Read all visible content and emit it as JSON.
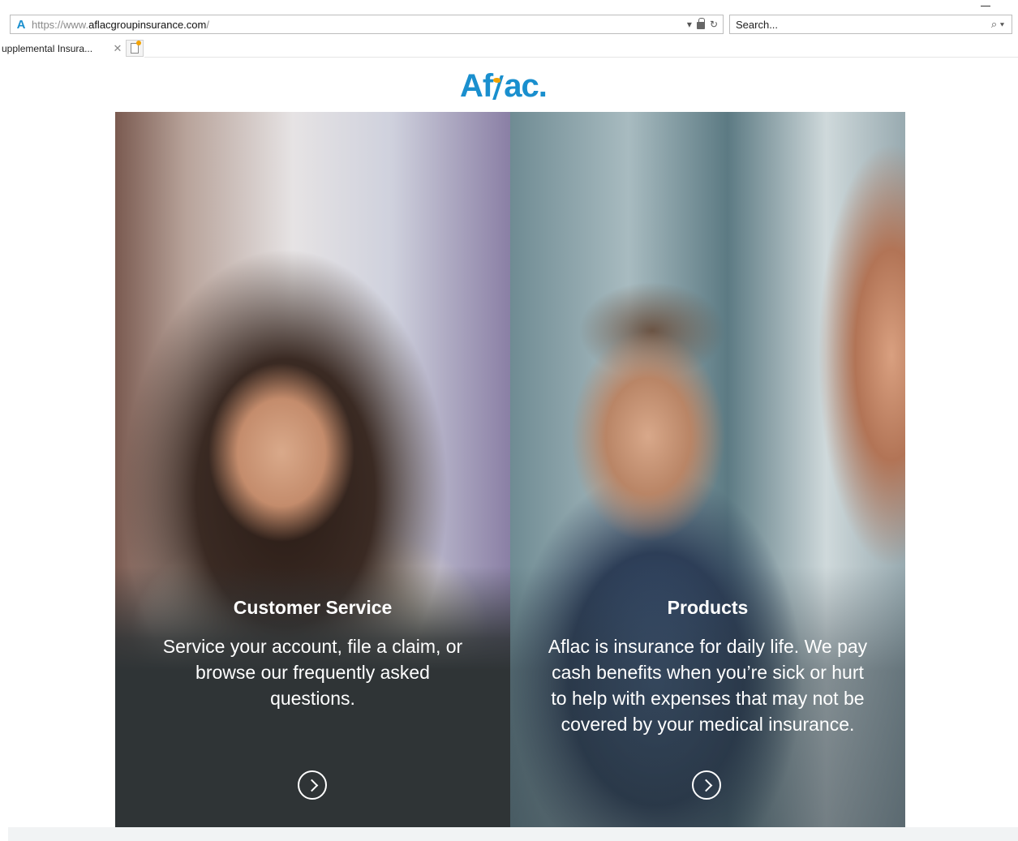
{
  "browser": {
    "url_scheme": "https://",
    "url_prefix": "www.",
    "url_host": "aflacgroupinsurance.com",
    "url_suffix": "/",
    "address_controls": "▾",
    "refresh_glyph": "↻",
    "search_placeholder": "Search...",
    "search_glyph": "⌕ ▾",
    "site_icon_glyph": "A",
    "tab_title": "upplemental Insura...",
    "tab_close_glyph": "✕"
  },
  "page": {
    "logo_text_before": "Af",
    "logo_text_after": "ac.",
    "brand_color": "#1a8fce",
    "accent_color": "#f4a300"
  },
  "panels": [
    {
      "heading": "Customer Service",
      "body": "Service your account, file a claim, or browse our frequently asked questions.",
      "button_icon": "chevron-right-circle-icon"
    },
    {
      "heading": "Products",
      "body": "Aflac is insurance for daily life. We pay cash benefits when you’re sick or hurt to help with expenses that may not be covered by your medical insurance.",
      "button_icon": "chevron-right-circle-icon"
    }
  ]
}
